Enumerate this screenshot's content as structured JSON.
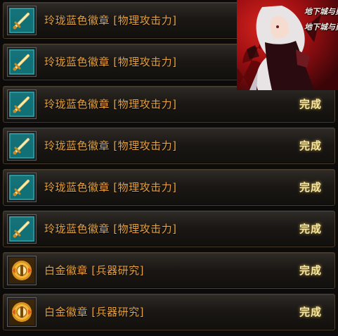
{
  "list": {
    "items": [
      {
        "label": "玲珑蓝色徽章 [物理攻击力]",
        "status": "",
        "icon": "sword-icon",
        "icon_color": "#0e5a63"
      },
      {
        "label": "玲珑蓝色徽章 [物理攻击力]",
        "status": "",
        "icon": "sword-icon",
        "icon_color": "#0e5a63"
      },
      {
        "label": "玲珑蓝色徽章 [物理攻击力]",
        "status": "完成",
        "icon": "sword-icon",
        "icon_color": "#0e5a63"
      },
      {
        "label": "玲珑蓝色徽章 [物理攻击力]",
        "status": "完成",
        "icon": "sword-icon",
        "icon_color": "#0e5a63"
      },
      {
        "label": "玲珑蓝色徽章 [物理攻击力]",
        "status": "完成",
        "icon": "sword-icon",
        "icon_color": "#0e5a63"
      },
      {
        "label": "玲珑蓝色徽章 [物理攻击力]",
        "status": "完成",
        "icon": "sword-icon",
        "icon_color": "#0e5a63"
      },
      {
        "label": "白金徽章 [兵器研究]",
        "status": "完成",
        "icon": "platinum-emblem-icon",
        "icon_color": "#d9921c"
      },
      {
        "label": "白金徽章 [兵器研究]",
        "status": "完成",
        "icon": "platinum-emblem-icon",
        "icon_color": "#d9921c"
      }
    ]
  },
  "promo": {
    "brand_top": "地下城与勇士",
    "brand_bottom": "地下城与勇士"
  },
  "colors": {
    "label_text": "#e6a23f",
    "status_text": "#f5e6a0",
    "row_border": "#4a3f2e"
  }
}
